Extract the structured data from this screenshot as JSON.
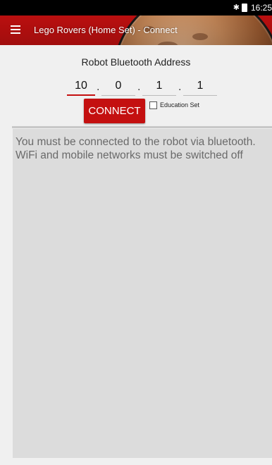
{
  "status_bar": {
    "time": "16:25",
    "icons": [
      "bluetooth-icon",
      "battery-icon"
    ]
  },
  "action_bar": {
    "title": "Lego Rovers (Home Set) - Connect",
    "menu_icon": "hamburger-icon",
    "accent": "#c41010"
  },
  "connect_form": {
    "label": "Robot Bluetooth Address",
    "ip": [
      "10",
      "0",
      "1",
      "1"
    ],
    "separator": ".",
    "button_label": "CONNECT",
    "education_label": "Education Set",
    "education_checked": false
  },
  "log": {
    "lines": [
      "You must be connected to the robot via bluetooth.",
      "WiFi and mobile networks must be switched off"
    ]
  }
}
